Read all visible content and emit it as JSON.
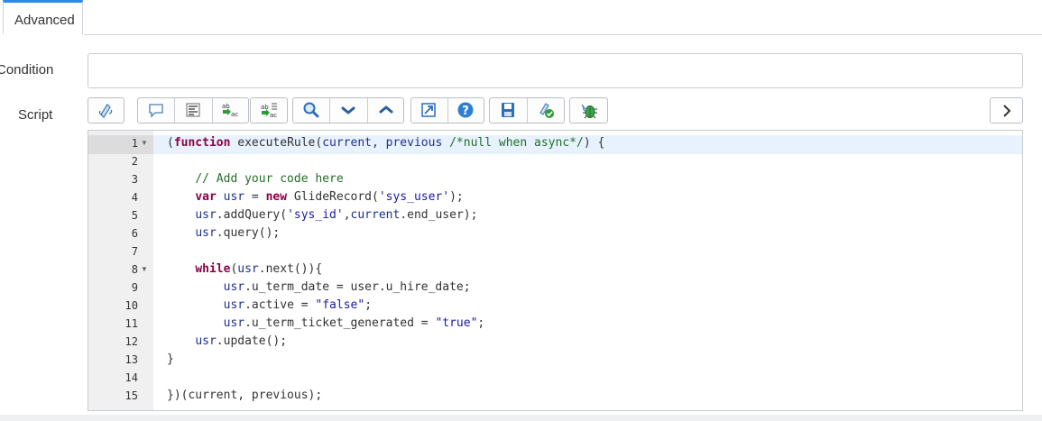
{
  "tab": {
    "label": "Advanced"
  },
  "form": {
    "condition_label": "Condition",
    "condition_value": "",
    "script_label": "Script"
  },
  "toolbar": {
    "buttons": [
      "toggle-syntax-icon",
      "comment-icon",
      "format-icon",
      "replace-icon",
      "replace-all-icon",
      "search-icon",
      "next-icon",
      "previous-icon",
      "fullscreen-icon",
      "help-icon",
      "save-icon",
      "script-check-icon",
      "debug-icon"
    ],
    "expand_icon": "chevron-right-icon"
  },
  "editor": {
    "lines": [
      {
        "n": "1",
        "fold": true
      },
      {
        "n": "2"
      },
      {
        "n": "3"
      },
      {
        "n": "4"
      },
      {
        "n": "5"
      },
      {
        "n": "6"
      },
      {
        "n": "7"
      },
      {
        "n": "8",
        "fold": true
      },
      {
        "n": "9"
      },
      {
        "n": "10"
      },
      {
        "n": "11"
      },
      {
        "n": "12"
      },
      {
        "n": "13"
      },
      {
        "n": "14"
      },
      {
        "n": "15"
      }
    ],
    "code": [
      [
        [
          "p",
          "("
        ],
        [
          "kw",
          "function"
        ],
        [
          "p",
          " executeRule("
        ],
        [
          "vr",
          "current"
        ],
        [
          "p",
          ", "
        ],
        [
          "vr",
          "previous"
        ],
        [
          "p",
          " "
        ],
        [
          "cm",
          "/*null when async*/"
        ],
        [
          "p",
          ") {"
        ]
      ],
      [],
      [
        [
          "p",
          "    "
        ],
        [
          "cm",
          "// Add your code here"
        ]
      ],
      [
        [
          "p",
          "    "
        ],
        [
          "kw",
          "var"
        ],
        [
          "p",
          " "
        ],
        [
          "vr",
          "usr"
        ],
        [
          "p",
          " = "
        ],
        [
          "kw",
          "new"
        ],
        [
          "p",
          " GlideRecord("
        ],
        [
          "st",
          "'sys_user'"
        ],
        [
          "p",
          ");"
        ]
      ],
      [
        [
          "p",
          "    "
        ],
        [
          "vr",
          "usr"
        ],
        [
          "p",
          ".addQuery("
        ],
        [
          "st",
          "'sys_id'"
        ],
        [
          "p",
          ","
        ],
        [
          "vr",
          "current"
        ],
        [
          "p",
          ".end_user);"
        ]
      ],
      [
        [
          "p",
          "    "
        ],
        [
          "vr",
          "usr"
        ],
        [
          "p",
          ".query();"
        ]
      ],
      [],
      [
        [
          "p",
          "    "
        ],
        [
          "kw",
          "while"
        ],
        [
          "p",
          "("
        ],
        [
          "vr",
          "usr"
        ],
        [
          "p",
          ".next()){"
        ]
      ],
      [
        [
          "p",
          "        "
        ],
        [
          "vr",
          "usr"
        ],
        [
          "p",
          ".u_term_date = user.u_hire_date;"
        ]
      ],
      [
        [
          "p",
          "        "
        ],
        [
          "vr",
          "usr"
        ],
        [
          "p",
          ".active = "
        ],
        [
          "st",
          "\"false\""
        ],
        [
          "p",
          ";"
        ]
      ],
      [
        [
          "p",
          "        "
        ],
        [
          "vr",
          "usr"
        ],
        [
          "p",
          ".u_term_ticket_generated = "
        ],
        [
          "st",
          "\"true\""
        ],
        [
          "p",
          ";"
        ]
      ],
      [
        [
          "p",
          "    "
        ],
        [
          "vr",
          "usr"
        ],
        [
          "p",
          ".update();"
        ]
      ],
      [
        [
          "p",
          "}"
        ]
      ],
      [],
      [
        [
          "p",
          "})(current, previous);"
        ]
      ]
    ]
  },
  "colors": {
    "accent": "#2e8ae6",
    "keyword": "#8b0047",
    "variable": "#1f2f8f",
    "comment": "#236e25",
    "string": "#1a1aa6"
  }
}
